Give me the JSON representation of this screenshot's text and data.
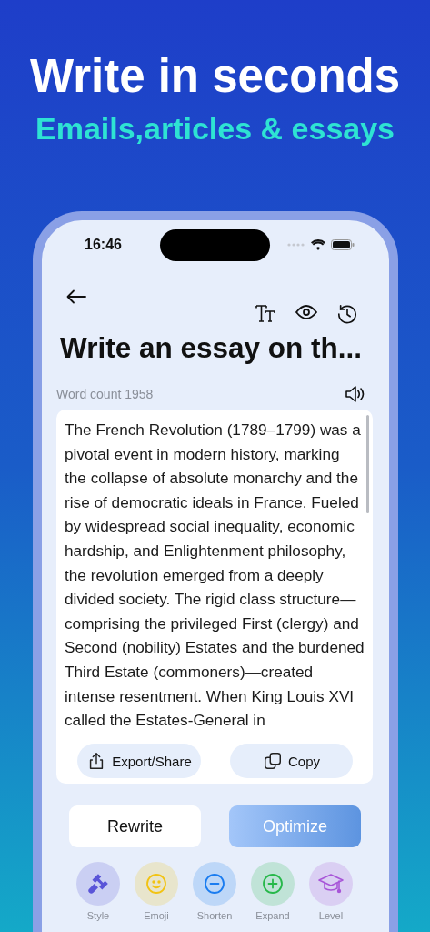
{
  "headline": "Write in seconds",
  "subheadline": "Emails,articles & essays",
  "status_bar": {
    "time": "16:46"
  },
  "title": "Write an essay on th...",
  "word_count": "Word count 1958",
  "essay": "The French Revolution (1789–1799) was a pivotal event in modern history, marking the collapse of absolute monarchy and the rise of democratic ideals in France. Fueled by widespread social inequality, economic hardship, and Enlightenment philosophy, the revolution emerged from a deeply divided society. The rigid class structure—comprising the privileged First (clergy) and Second (nobility) Estates and the burdened Third Estate (commoners)—created intense resentment. When King Louis XVI called the Estates-General in",
  "card_actions": [
    {
      "label": "Export/Share"
    },
    {
      "label": "Copy"
    }
  ],
  "buttons": [
    {
      "label": "Rewrite",
      "kind": "secondary"
    },
    {
      "label": "Optimize",
      "kind": "primary"
    }
  ],
  "tools": [
    {
      "label": "Style",
      "color": "#5a55d8"
    },
    {
      "label": "Emoji",
      "color": "#f2c312"
    },
    {
      "label": "Shorten",
      "color": "#1a7cf0"
    },
    {
      "label": "Expand",
      "color": "#27b84a"
    },
    {
      "label": "Level",
      "color": "#a855d8"
    }
  ]
}
